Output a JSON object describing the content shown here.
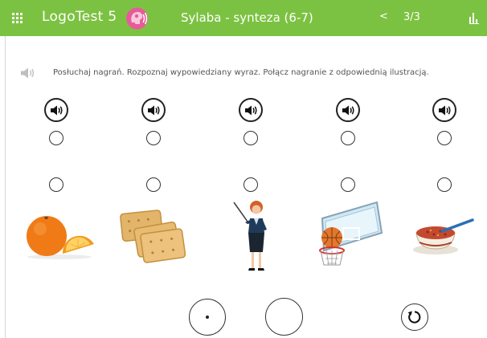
{
  "header": {
    "app_title": "LogoTest 5",
    "module_title": "Sylaba - synteza (6-7)",
    "prev_label": "<",
    "page_counter": "3/3",
    "background_color": "#7cc242",
    "icons": {
      "menu": "grid-icon",
      "logo": "logotest-logo",
      "stats": "bar-chart-icon"
    }
  },
  "instruction": {
    "icon": "speaker-icon",
    "text": "Posłuchaj nagrań. Rozpoznaj wypowiedziany wyraz. Połącz nagranie z odpowiednią ilustracją."
  },
  "recordings": [
    {
      "icon": "speaker-icon"
    },
    {
      "icon": "speaker-icon"
    },
    {
      "icon": "speaker-icon"
    },
    {
      "icon": "speaker-icon"
    },
    {
      "icon": "speaker-icon"
    }
  ],
  "pictures": [
    {
      "icon": "orange-picture"
    },
    {
      "icon": "crackers-picture"
    },
    {
      "icon": "teacher-picture"
    },
    {
      "icon": "basketball-hoop-picture"
    },
    {
      "icon": "soup-bowl-picture"
    }
  ],
  "controls": {
    "record": "record-button",
    "stop": "stop-button",
    "reset": "reset-icon"
  }
}
